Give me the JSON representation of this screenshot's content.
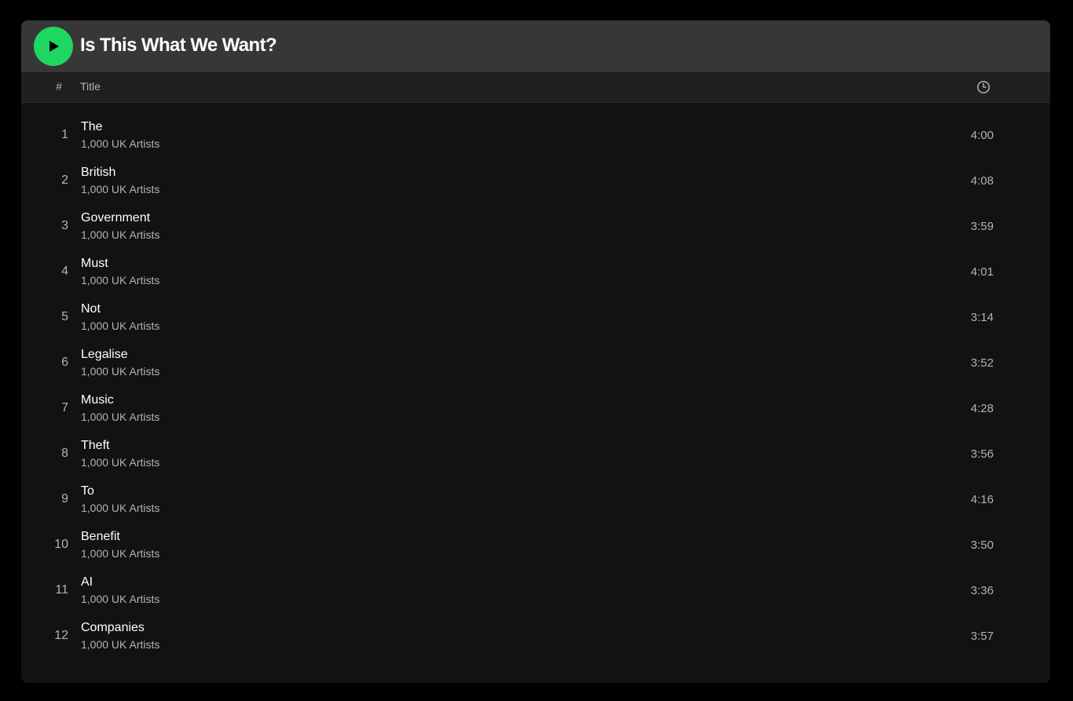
{
  "playlist": {
    "title": "Is This What We Want?"
  },
  "columns": {
    "number": "#",
    "title": "Title",
    "duration_icon": "clock-icon"
  },
  "colors": {
    "accent": "#1ed760",
    "background": "#121212",
    "header_bar": "#373737",
    "text_primary": "#ffffff",
    "text_secondary": "#b3b3b3"
  },
  "tracks": [
    {
      "number": "1",
      "title": "The",
      "artist": "1,000 UK Artists",
      "duration": "4:00"
    },
    {
      "number": "2",
      "title": "British",
      "artist": "1,000 UK Artists",
      "duration": "4:08"
    },
    {
      "number": "3",
      "title": "Government",
      "artist": "1,000 UK Artists",
      "duration": "3:59"
    },
    {
      "number": "4",
      "title": "Must",
      "artist": "1,000 UK Artists",
      "duration": "4:01"
    },
    {
      "number": "5",
      "title": "Not",
      "artist": "1,000 UK Artists",
      "duration": "3:14"
    },
    {
      "number": "6",
      "title": "Legalise",
      "artist": "1,000 UK Artists",
      "duration": "3:52"
    },
    {
      "number": "7",
      "title": "Music",
      "artist": "1,000 UK Artists",
      "duration": "4:28"
    },
    {
      "number": "8",
      "title": "Theft",
      "artist": "1,000 UK Artists",
      "duration": "3:56"
    },
    {
      "number": "9",
      "title": "To",
      "artist": "1,000 UK Artists",
      "duration": "4:16"
    },
    {
      "number": "10",
      "title": "Benefit",
      "artist": "1,000 UK Artists",
      "duration": "3:50"
    },
    {
      "number": "11",
      "title": "AI",
      "artist": "1,000 UK Artists",
      "duration": "3:36"
    },
    {
      "number": "12",
      "title": "Companies",
      "artist": "1,000 UK Artists",
      "duration": "3:57"
    }
  ]
}
